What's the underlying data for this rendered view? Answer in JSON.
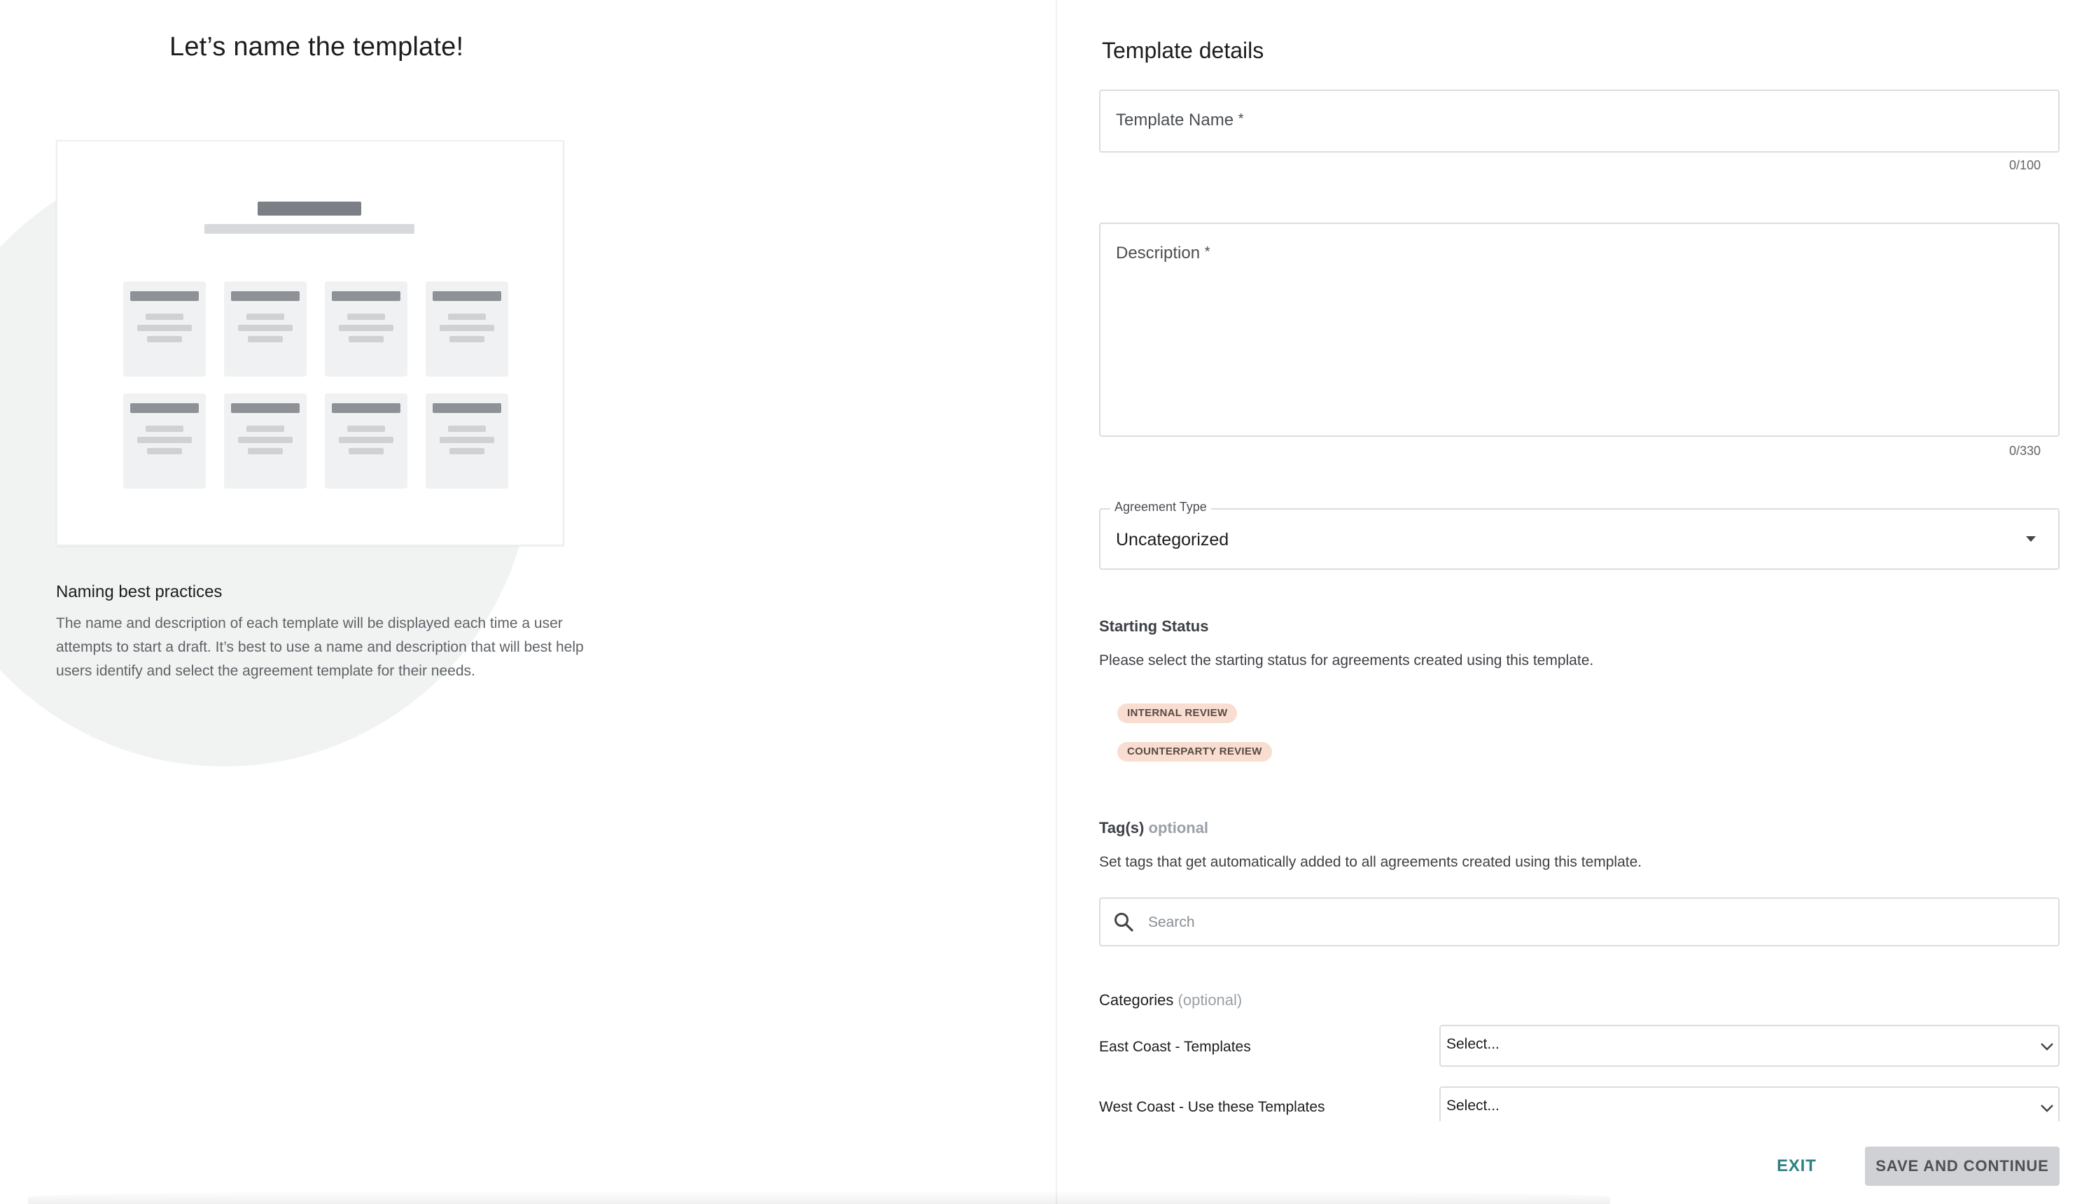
{
  "left": {
    "page_title": "Let’s name the template!",
    "best_practices": {
      "heading": "Naming best practices",
      "line1": "The name and description of each template will be displayed each time a user",
      "line2": "attempts to start a draft. It’s best to use a name and description that will best help",
      "line3": "users identify and select the agreement template for their needs."
    }
  },
  "form": {
    "title": "Template details",
    "template_name": {
      "label": "Template Name",
      "required_mark": "*",
      "value": "",
      "counter": "0/100"
    },
    "description": {
      "label": "Description",
      "required_mark": "*",
      "value": "",
      "counter": "0/330"
    },
    "agreement_type": {
      "label": "Agreement Type",
      "value": "Uncategorized"
    },
    "starting_status": {
      "heading": "Starting Status",
      "description": "Please select the starting status for agreements created using this template.",
      "options": [
        "INTERNAL REVIEW",
        "COUNTERPARTY REVIEW"
      ]
    },
    "tags": {
      "heading": "Tag(s)",
      "optional": "optional",
      "description": "Set tags that get automatically added to all agreements created using this template.",
      "search_placeholder": "Search"
    },
    "categories": {
      "heading": "Categories",
      "optional": "(optional)",
      "rows": [
        {
          "label": "East Coast - Templates",
          "value": "Select..."
        },
        {
          "label": "West Coast - Use these Templates",
          "value": "Select..."
        }
      ]
    }
  },
  "footer": {
    "exit_label": "EXIT",
    "save_label": "SAVE AND CONTINUE"
  },
  "colors": {
    "accent": "#2e7f83",
    "status_pill_bg": "#f8ddd0",
    "save_button_bg": "#cfd1d4"
  }
}
